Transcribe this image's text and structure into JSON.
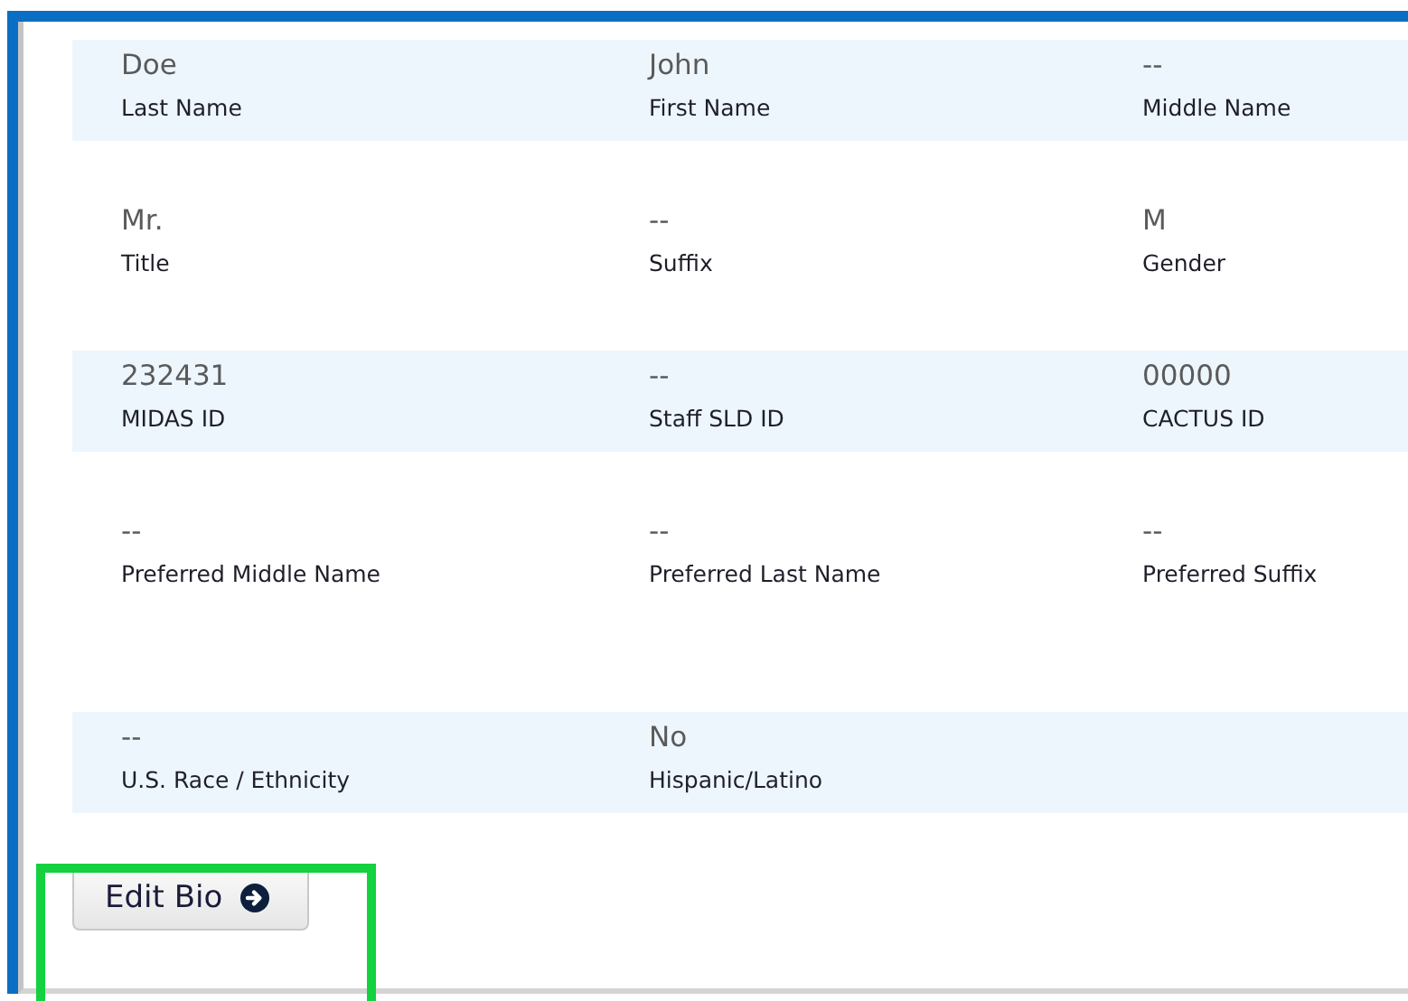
{
  "rows": [
    {
      "fields": [
        {
          "value": "Doe",
          "label": "Last Name"
        },
        {
          "value": "John",
          "label": "First Name"
        },
        {
          "value": "--",
          "label": "Middle Name"
        }
      ]
    },
    {
      "fields": [
        {
          "value": "Mr.",
          "label": "Title"
        },
        {
          "value": "--",
          "label": "Suffix"
        },
        {
          "value": "M",
          "label": "Gender"
        }
      ]
    },
    {
      "fields": [
        {
          "value": "232431",
          "label": "MIDAS ID"
        },
        {
          "value": "--",
          "label": "Staff SLD ID"
        },
        {
          "value": "00000",
          "label": "CACTUS ID"
        }
      ]
    },
    {
      "fields": [
        {
          "value": "--",
          "label": "Preferred Middle Name"
        },
        {
          "value": "--",
          "label": "Preferred Last Name"
        },
        {
          "value": "--",
          "label": "Preferred Suffix"
        }
      ]
    },
    {
      "fields": [
        {
          "value": "--",
          "label": "U.S. Race / Ethnicity"
        },
        {
          "value": "No",
          "label": "Hispanic/Latino"
        }
      ]
    }
  ],
  "button": {
    "label": "Edit Bio",
    "highlighted": true
  }
}
